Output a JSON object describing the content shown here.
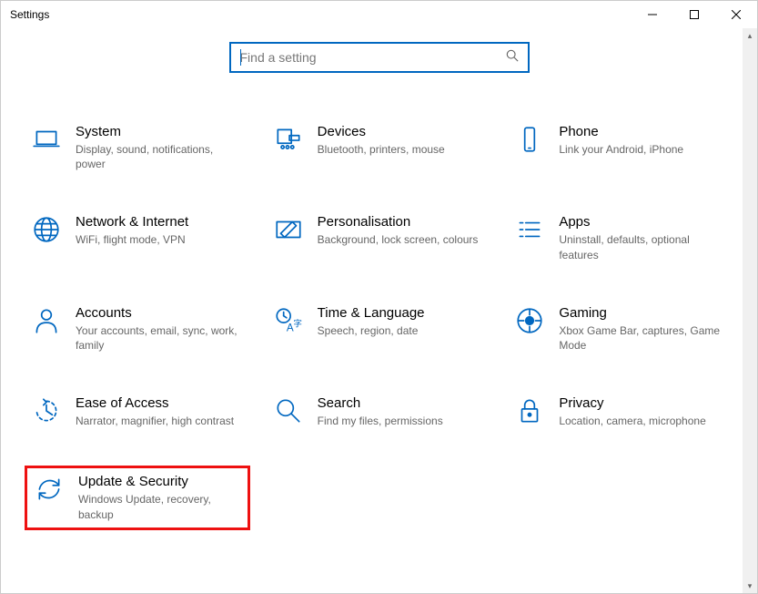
{
  "window": {
    "title": "Settings"
  },
  "search": {
    "placeholder": "Find a setting",
    "value": ""
  },
  "categories": [
    {
      "id": "system",
      "title": "System",
      "desc": "Display, sound, notifications, power",
      "icon": "laptop",
      "highlighted": false
    },
    {
      "id": "devices",
      "title": "Devices",
      "desc": "Bluetooth, printers, mouse",
      "icon": "devices",
      "highlighted": false
    },
    {
      "id": "phone",
      "title": "Phone",
      "desc": "Link your Android, iPhone",
      "icon": "phone",
      "highlighted": false
    },
    {
      "id": "network",
      "title": "Network & Internet",
      "desc": "WiFi, flight mode, VPN",
      "icon": "globe",
      "highlighted": false
    },
    {
      "id": "personalisation",
      "title": "Personalisation",
      "desc": "Background, lock screen, colours",
      "icon": "pen",
      "highlighted": false
    },
    {
      "id": "apps",
      "title": "Apps",
      "desc": "Uninstall, defaults, optional features",
      "icon": "list",
      "highlighted": false
    },
    {
      "id": "accounts",
      "title": "Accounts",
      "desc": "Your accounts, email, sync, work, family",
      "icon": "person",
      "highlighted": false
    },
    {
      "id": "time",
      "title": "Time & Language",
      "desc": "Speech, region, date",
      "icon": "time-lang",
      "highlighted": false
    },
    {
      "id": "gaming",
      "title": "Gaming",
      "desc": "Xbox Game Bar, captures, Game Mode",
      "icon": "gaming",
      "highlighted": false
    },
    {
      "id": "ease",
      "title": "Ease of Access",
      "desc": "Narrator, magnifier, high contrast",
      "icon": "ease",
      "highlighted": false
    },
    {
      "id": "search",
      "title": "Search",
      "desc": "Find my files, permissions",
      "icon": "search",
      "highlighted": false
    },
    {
      "id": "privacy",
      "title": "Privacy",
      "desc": "Location, camera, microphone",
      "icon": "lock",
      "highlighted": false
    },
    {
      "id": "update",
      "title": "Update & Security",
      "desc": "Windows Update, recovery, backup",
      "icon": "sync",
      "highlighted": true
    }
  ]
}
